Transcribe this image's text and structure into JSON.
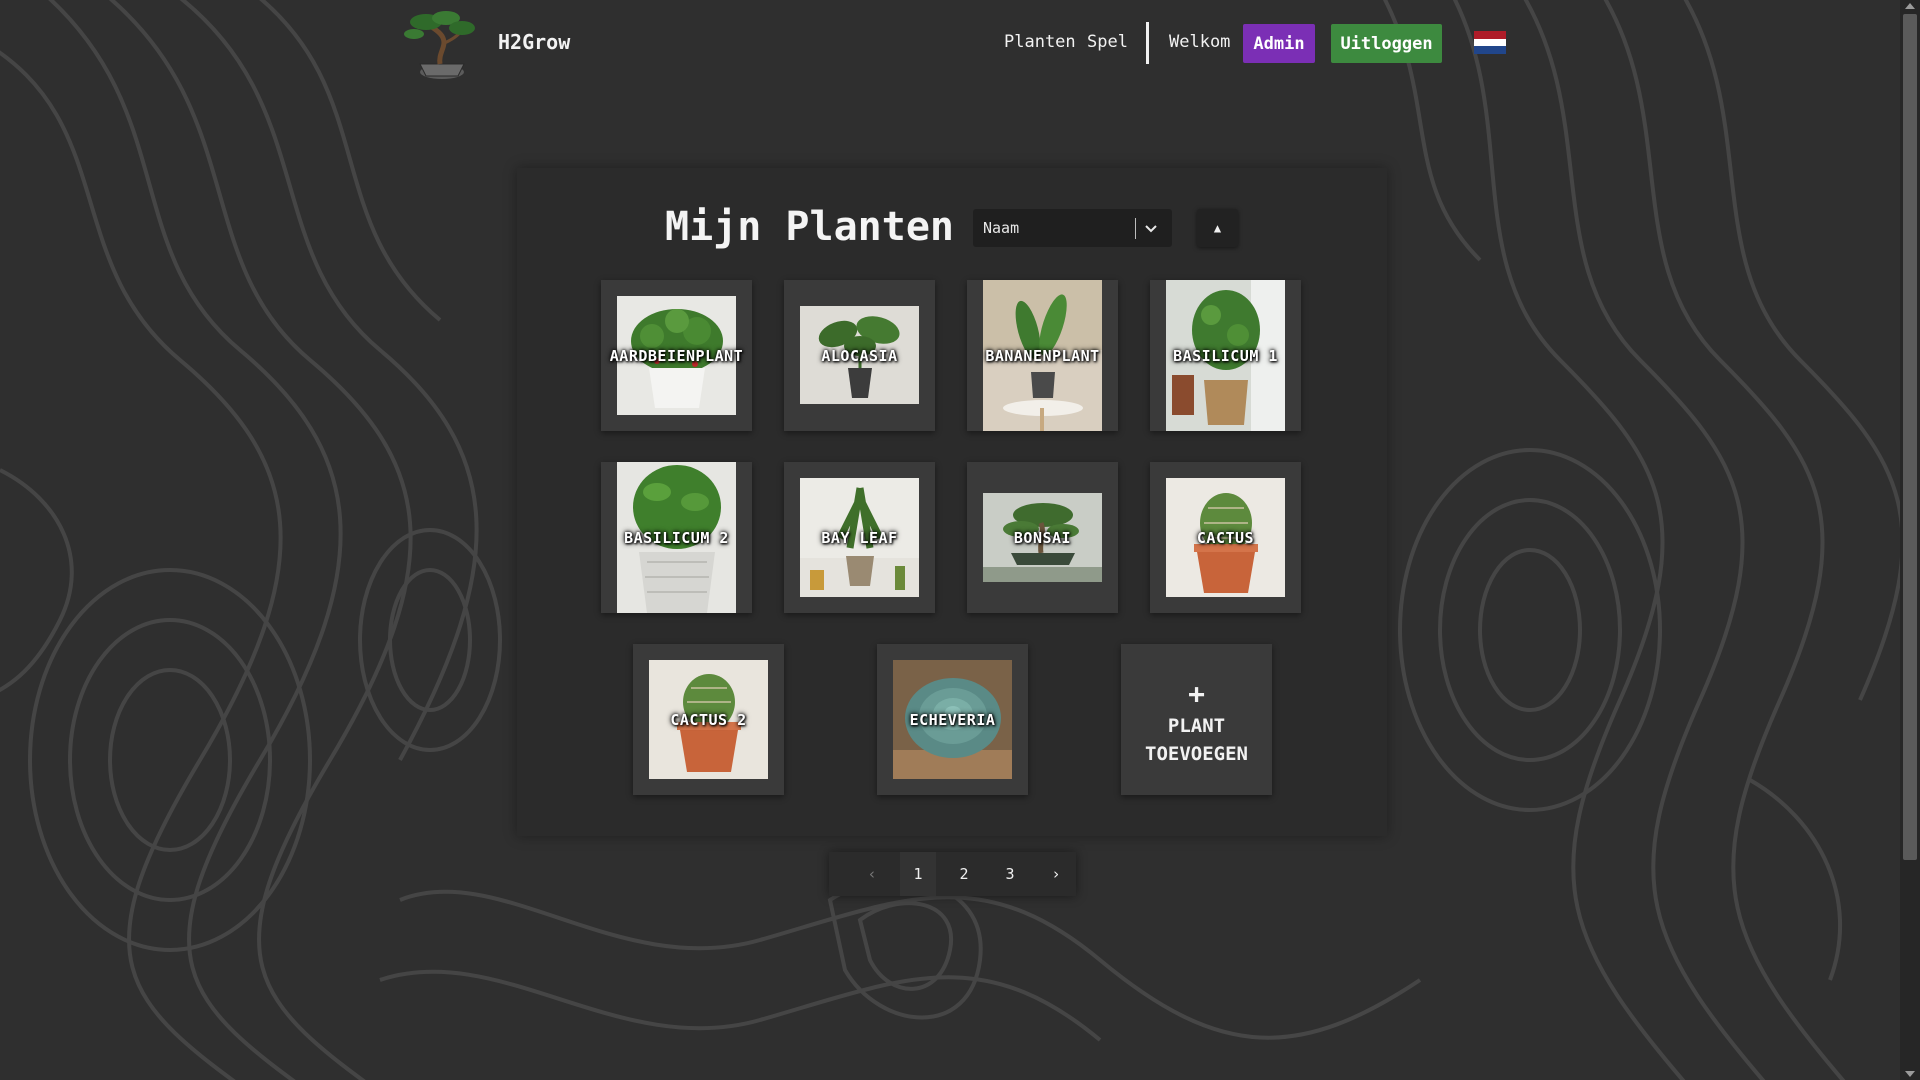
{
  "header": {
    "brand": "H2Grow",
    "nav": {
      "planten": "Planten",
      "spel": "Spel",
      "welkom": "Welkom",
      "admin": "Admin",
      "uitloggen": "Uitloggen"
    },
    "language_flag": "netherlands-flag-icon",
    "colors": {
      "admin": "#7b2fb5",
      "logout": "#3d8a3f"
    }
  },
  "main": {
    "title": "Mijn Planten",
    "sort": {
      "selected": "Naam",
      "direction_glyph": "▲"
    },
    "plants": [
      {
        "name": "AARDBEIENPLANT"
      },
      {
        "name": "ALOCASIA"
      },
      {
        "name": "BANANENPLANT"
      },
      {
        "name": "BASILICUM 1"
      },
      {
        "name": "BASILICUM 2"
      },
      {
        "name": "BAY LEAF"
      },
      {
        "name": "BONSAI"
      },
      {
        "name": "CACTUS"
      },
      {
        "name": "CACTUS 2"
      },
      {
        "name": "ECHEVERIA"
      }
    ],
    "add_card": {
      "plus": "+",
      "line1": "PLANT",
      "line2": "TOEVOEGEN"
    }
  },
  "pagination": {
    "prev": "‹",
    "pages": [
      "1",
      "2",
      "3"
    ],
    "current": "1",
    "next": "›"
  }
}
